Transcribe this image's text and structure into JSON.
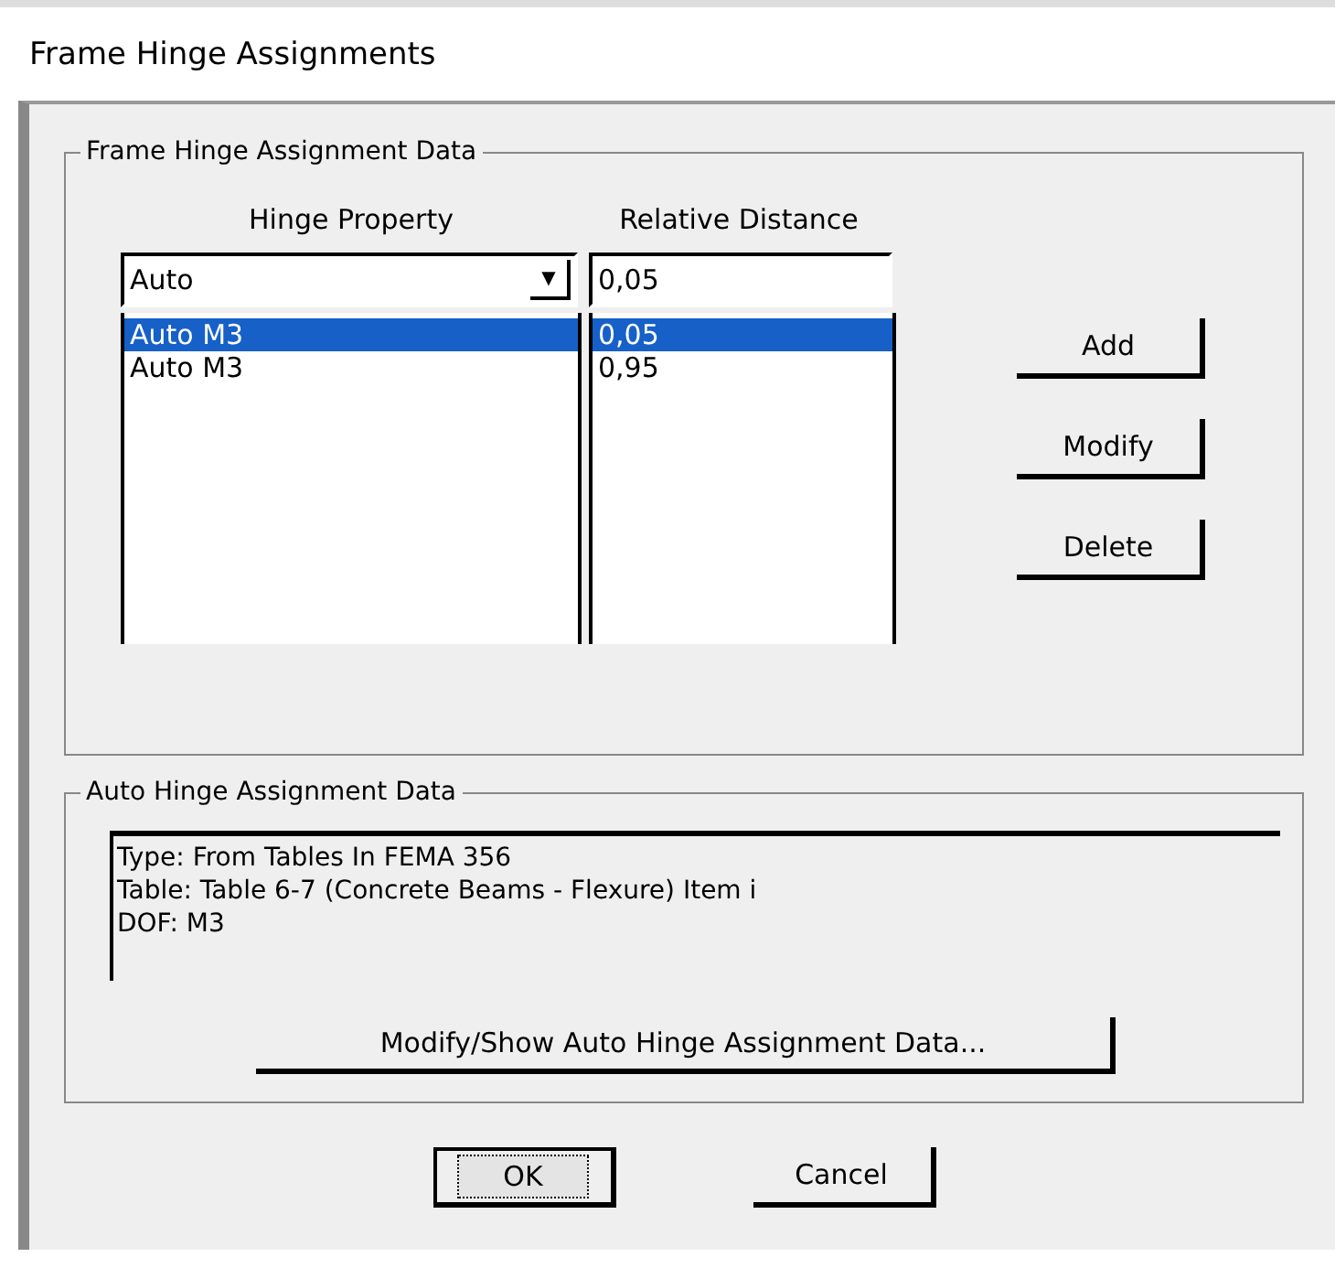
{
  "window": {
    "title": "Frame Hinge Assignments"
  },
  "assignment_group": {
    "title": "Frame Hinge Assignment Data",
    "columns": [
      "Hinge Property",
      "Relative Distance"
    ],
    "hinge_property": {
      "value": "Auto",
      "dropdown_arrow": "▼"
    },
    "relative_distance": {
      "value": "0,05"
    },
    "rows": [
      {
        "property": "Auto  M3",
        "distance": "0,05",
        "selected": true
      },
      {
        "property": "Auto  M3",
        "distance": "0,95",
        "selected": false
      }
    ],
    "buttons": [
      "Add",
      "Modify",
      "Delete"
    ]
  },
  "auto_group": {
    "title": "Auto Hinge Assignment Data",
    "lines": [
      "Type:  From Tables In FEMA 356",
      "Table:  Table 6-7 (Concrete Beams - Flexure) Item i",
      "DOF:  M3"
    ],
    "button": "Modify/Show Auto Hinge Assignment Data..."
  },
  "buttons": [
    {
      "label": "OK",
      "focused": true
    },
    {
      "label": "Cancel",
      "focused": false
    }
  ]
}
